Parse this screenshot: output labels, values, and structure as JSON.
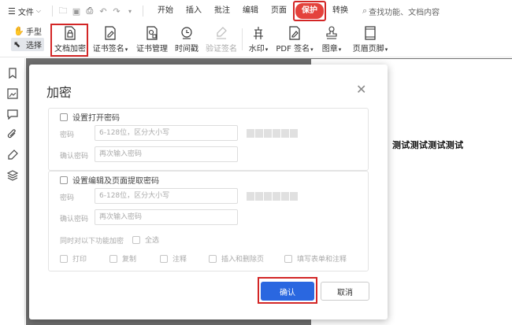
{
  "menubar": {
    "file_label": "文件",
    "tabs": [
      "开始",
      "插入",
      "批注",
      "编辑",
      "页面",
      "保护",
      "转换"
    ],
    "active_tab": "保护",
    "search_placeholder": "查找功能、文档内容"
  },
  "toolbar": {
    "hand": "手型",
    "select": "选择",
    "buttons": [
      {
        "label": "文档加密",
        "icon": "lock-document-icon"
      },
      {
        "label": "证书签名",
        "icon": "certificate-sign-icon",
        "dropdown": true
      },
      {
        "label": "证书管理",
        "icon": "certificate-manage-icon"
      },
      {
        "label": "时间戳",
        "icon": "timestamp-icon"
      },
      {
        "label": "验证签名",
        "icon": "verify-signature-icon",
        "disabled": true
      },
      {
        "label": "水印",
        "icon": "watermark-icon",
        "dropdown": true
      },
      {
        "label": "PDF 签名",
        "icon": "pdf-sign-icon",
        "dropdown": true
      },
      {
        "label": "图章",
        "icon": "stamp-icon",
        "dropdown": true
      },
      {
        "label": "页眉页脚",
        "icon": "header-footer-icon",
        "dropdown": true
      }
    ]
  },
  "document": {
    "text": "测试测试测试测试"
  },
  "dialog": {
    "title": "加密",
    "open_password": {
      "checkbox_label": "设置打开密码",
      "password_label": "密码",
      "password_placeholder": "6-128位，区分大小写",
      "confirm_label": "确认密码",
      "confirm_placeholder": "再次输入密码"
    },
    "edit_password": {
      "checkbox_label": "设置编辑及页面提取密码",
      "password_label": "密码",
      "password_placeholder": "6-128位，区分大小写",
      "confirm_label": "确认密码",
      "confirm_placeholder": "再次输入密码",
      "restrict_label": "同时对以下功能加密",
      "select_all": "全选",
      "options": [
        "打印",
        "复制",
        "注释",
        "插入和删除页",
        "填写表单和注释"
      ]
    },
    "confirm_button": "确认",
    "cancel_button": "取消"
  },
  "colors": {
    "accent": "#2a67e0",
    "active_tab": "#e4423c",
    "highlight": "#d32626"
  }
}
